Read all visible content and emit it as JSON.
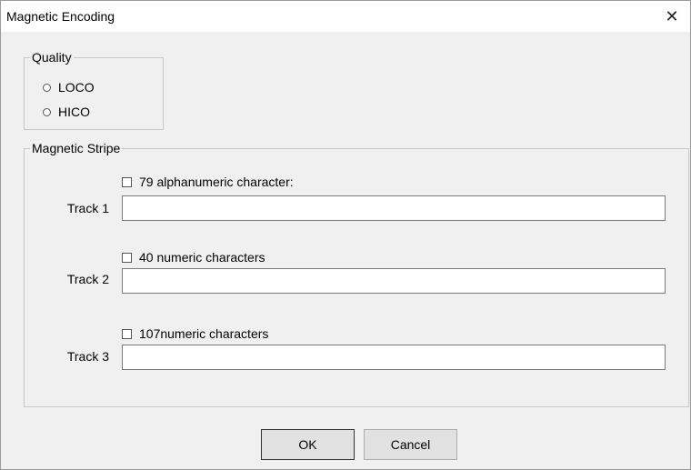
{
  "window": {
    "title": "Magnetic Encoding",
    "close_glyph": "✕"
  },
  "quality": {
    "legend": "Quality",
    "options": [
      {
        "label": "LOCO",
        "selected": false
      },
      {
        "label": "HICO",
        "selected": false
      }
    ]
  },
  "stripe": {
    "legend": "Magnetic Stripe",
    "tracks": [
      {
        "checkbox_label": "79 alphanumeric character:",
        "checked": false,
        "label": "Track 1",
        "value": ""
      },
      {
        "checkbox_label": "40 numeric characters",
        "checked": false,
        "label": "Track 2",
        "value": ""
      },
      {
        "checkbox_label": "107numeric characters",
        "checked": false,
        "label": "Track 3",
        "value": ""
      }
    ]
  },
  "buttons": {
    "ok": "OK",
    "cancel": "Cancel"
  }
}
